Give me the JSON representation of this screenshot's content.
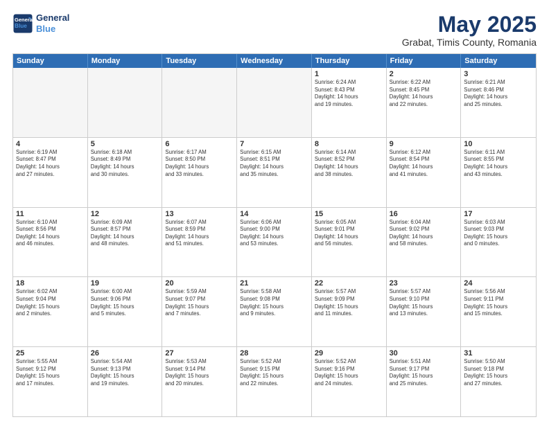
{
  "logo": {
    "line1": "General",
    "line2": "Blue"
  },
  "title": "May 2025",
  "subtitle": "Grabat, Timis County, Romania",
  "header_days": [
    "Sunday",
    "Monday",
    "Tuesday",
    "Wednesday",
    "Thursday",
    "Friday",
    "Saturday"
  ],
  "weeks": [
    [
      {
        "day": "",
        "info": ""
      },
      {
        "day": "",
        "info": ""
      },
      {
        "day": "",
        "info": ""
      },
      {
        "day": "",
        "info": ""
      },
      {
        "day": "1",
        "info": "Sunrise: 6:24 AM\nSunset: 8:43 PM\nDaylight: 14 hours\nand 19 minutes."
      },
      {
        "day": "2",
        "info": "Sunrise: 6:22 AM\nSunset: 8:45 PM\nDaylight: 14 hours\nand 22 minutes."
      },
      {
        "day": "3",
        "info": "Sunrise: 6:21 AM\nSunset: 8:46 PM\nDaylight: 14 hours\nand 25 minutes."
      }
    ],
    [
      {
        "day": "4",
        "info": "Sunrise: 6:19 AM\nSunset: 8:47 PM\nDaylight: 14 hours\nand 27 minutes."
      },
      {
        "day": "5",
        "info": "Sunrise: 6:18 AM\nSunset: 8:49 PM\nDaylight: 14 hours\nand 30 minutes."
      },
      {
        "day": "6",
        "info": "Sunrise: 6:17 AM\nSunset: 8:50 PM\nDaylight: 14 hours\nand 33 minutes."
      },
      {
        "day": "7",
        "info": "Sunrise: 6:15 AM\nSunset: 8:51 PM\nDaylight: 14 hours\nand 35 minutes."
      },
      {
        "day": "8",
        "info": "Sunrise: 6:14 AM\nSunset: 8:52 PM\nDaylight: 14 hours\nand 38 minutes."
      },
      {
        "day": "9",
        "info": "Sunrise: 6:12 AM\nSunset: 8:54 PM\nDaylight: 14 hours\nand 41 minutes."
      },
      {
        "day": "10",
        "info": "Sunrise: 6:11 AM\nSunset: 8:55 PM\nDaylight: 14 hours\nand 43 minutes."
      }
    ],
    [
      {
        "day": "11",
        "info": "Sunrise: 6:10 AM\nSunset: 8:56 PM\nDaylight: 14 hours\nand 46 minutes."
      },
      {
        "day": "12",
        "info": "Sunrise: 6:09 AM\nSunset: 8:57 PM\nDaylight: 14 hours\nand 48 minutes."
      },
      {
        "day": "13",
        "info": "Sunrise: 6:07 AM\nSunset: 8:59 PM\nDaylight: 14 hours\nand 51 minutes."
      },
      {
        "day": "14",
        "info": "Sunrise: 6:06 AM\nSunset: 9:00 PM\nDaylight: 14 hours\nand 53 minutes."
      },
      {
        "day": "15",
        "info": "Sunrise: 6:05 AM\nSunset: 9:01 PM\nDaylight: 14 hours\nand 56 minutes."
      },
      {
        "day": "16",
        "info": "Sunrise: 6:04 AM\nSunset: 9:02 PM\nDaylight: 14 hours\nand 58 minutes."
      },
      {
        "day": "17",
        "info": "Sunrise: 6:03 AM\nSunset: 9:03 PM\nDaylight: 15 hours\nand 0 minutes."
      }
    ],
    [
      {
        "day": "18",
        "info": "Sunrise: 6:02 AM\nSunset: 9:04 PM\nDaylight: 15 hours\nand 2 minutes."
      },
      {
        "day": "19",
        "info": "Sunrise: 6:00 AM\nSunset: 9:06 PM\nDaylight: 15 hours\nand 5 minutes."
      },
      {
        "day": "20",
        "info": "Sunrise: 5:59 AM\nSunset: 9:07 PM\nDaylight: 15 hours\nand 7 minutes."
      },
      {
        "day": "21",
        "info": "Sunrise: 5:58 AM\nSunset: 9:08 PM\nDaylight: 15 hours\nand 9 minutes."
      },
      {
        "day": "22",
        "info": "Sunrise: 5:57 AM\nSunset: 9:09 PM\nDaylight: 15 hours\nand 11 minutes."
      },
      {
        "day": "23",
        "info": "Sunrise: 5:57 AM\nSunset: 9:10 PM\nDaylight: 15 hours\nand 13 minutes."
      },
      {
        "day": "24",
        "info": "Sunrise: 5:56 AM\nSunset: 9:11 PM\nDaylight: 15 hours\nand 15 minutes."
      }
    ],
    [
      {
        "day": "25",
        "info": "Sunrise: 5:55 AM\nSunset: 9:12 PM\nDaylight: 15 hours\nand 17 minutes."
      },
      {
        "day": "26",
        "info": "Sunrise: 5:54 AM\nSunset: 9:13 PM\nDaylight: 15 hours\nand 19 minutes."
      },
      {
        "day": "27",
        "info": "Sunrise: 5:53 AM\nSunset: 9:14 PM\nDaylight: 15 hours\nand 20 minutes."
      },
      {
        "day": "28",
        "info": "Sunrise: 5:52 AM\nSunset: 9:15 PM\nDaylight: 15 hours\nand 22 minutes."
      },
      {
        "day": "29",
        "info": "Sunrise: 5:52 AM\nSunset: 9:16 PM\nDaylight: 15 hours\nand 24 minutes."
      },
      {
        "day": "30",
        "info": "Sunrise: 5:51 AM\nSunset: 9:17 PM\nDaylight: 15 hours\nand 25 minutes."
      },
      {
        "day": "31",
        "info": "Sunrise: 5:50 AM\nSunset: 9:18 PM\nDaylight: 15 hours\nand 27 minutes."
      }
    ]
  ]
}
